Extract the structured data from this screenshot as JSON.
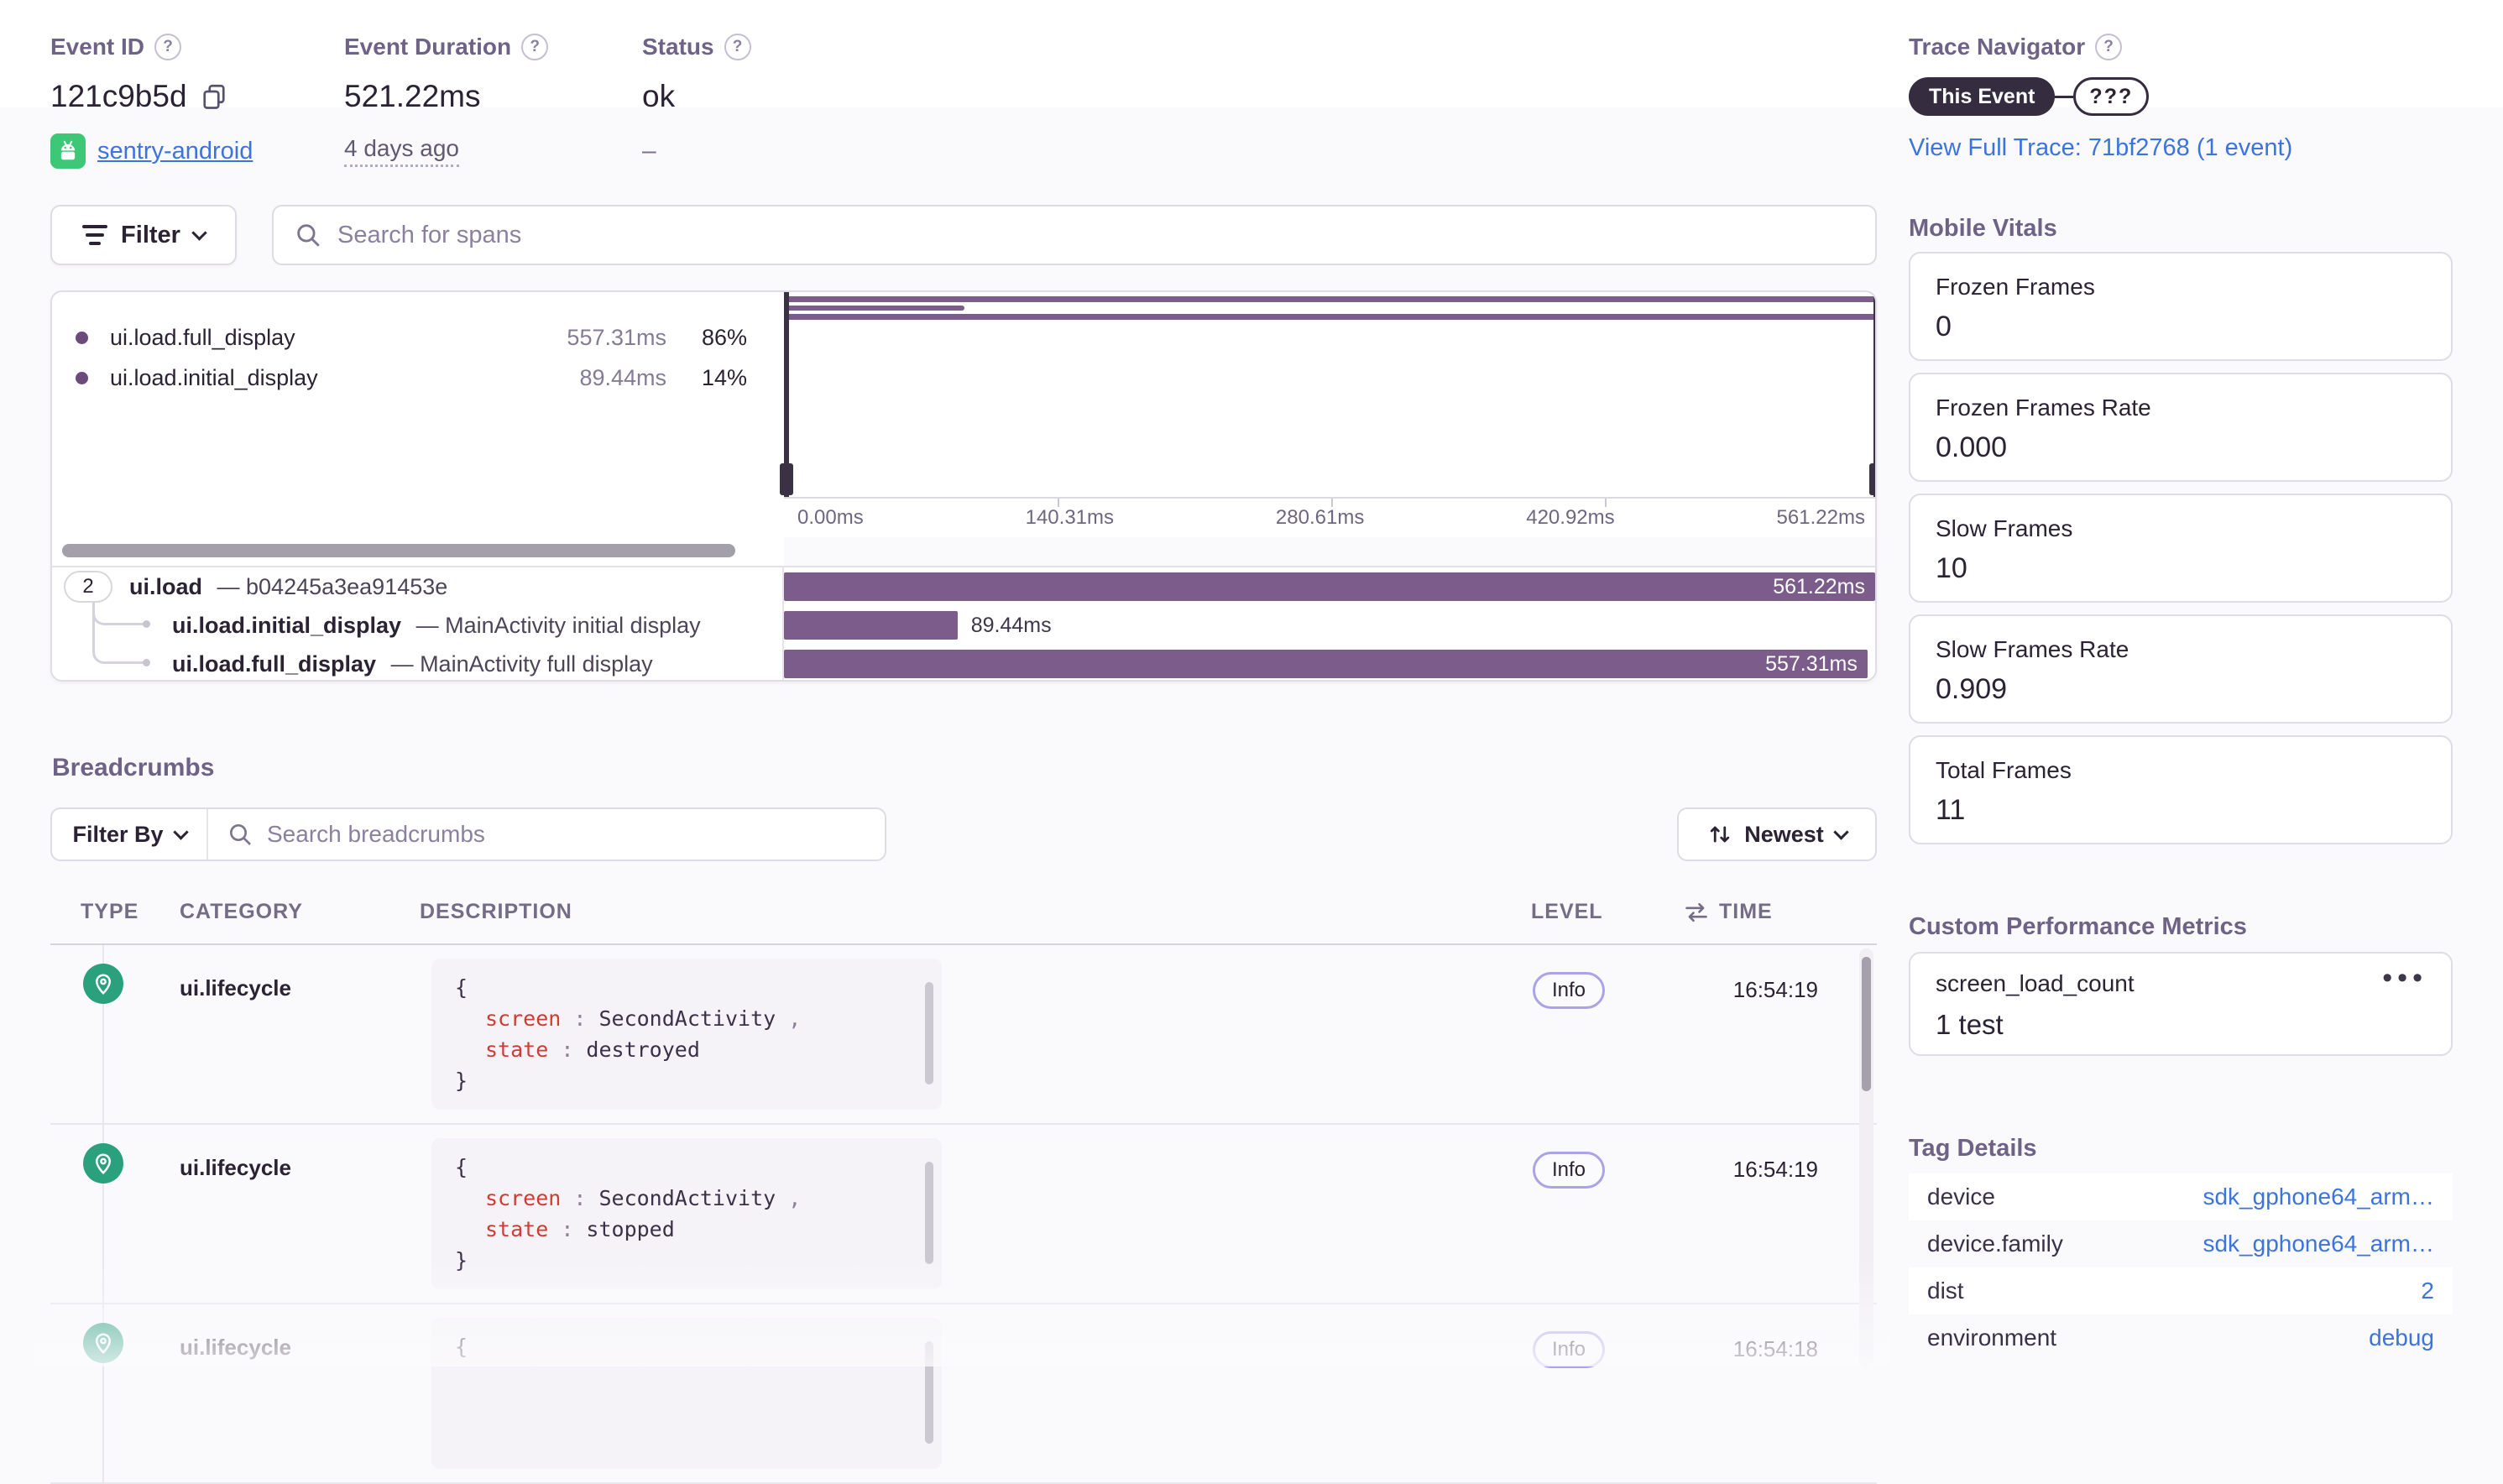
{
  "colors": {
    "accent_bar_purple": "#7B5C8A",
    "dark_pill_purple": "#352C3F",
    "link_blue": "#3C74DD",
    "section_label_gray": "#6F6287",
    "text_dark": "#2B2233",
    "breadcrumb_green": "#2AA07D",
    "android_green": "#3DC878",
    "code_key_red": "#D03B34",
    "info_badge_border": "#ABA2E8"
  },
  "icons": {
    "help": "?",
    "ellipsis": "•••"
  },
  "header": {
    "event_id": {
      "label": "Event ID",
      "value": "121c9b5d",
      "project": "sentry-android"
    },
    "event_duration": {
      "label": "Event Duration",
      "value": "521.22ms",
      "age": "4 days ago"
    },
    "status": {
      "label": "Status",
      "value": "ok",
      "sub": "–"
    }
  },
  "trace_navigator": {
    "label": "Trace Navigator",
    "this_event_pill": "This Event",
    "next_pill": "???",
    "link": "View Full Trace: 71bf2768 (1 event)"
  },
  "span_toolbar": {
    "filter_label": "Filter",
    "search_placeholder": "Search for spans"
  },
  "span_legend": {
    "rows": [
      {
        "name": "ui.load.full_display",
        "duration": "557.31ms",
        "pct": "86%"
      },
      {
        "name": "ui.load.initial_display",
        "duration": "89.44ms",
        "pct": "14%"
      }
    ]
  },
  "minimap": {
    "axis_labels": [
      "0.00ms",
      "140.31ms",
      "280.61ms",
      "420.92ms",
      "561.22ms"
    ],
    "bar1_style": "width:100%",
    "bar2_style": "width:16%",
    "bar3_style": "width:99.3%"
  },
  "span_tree": {
    "rows": [
      {
        "count": "2",
        "name": "ui.load",
        "suffix": "— b04245a3ea91453e",
        "duration": "561.22ms",
        "bar_style": "width:100%"
      },
      {
        "name": "ui.load.initial_display",
        "suffix": "— MainActivity initial display",
        "duration": "89.44ms",
        "bar_style": "width:15.9%"
      },
      {
        "name": "ui.load.full_display",
        "suffix": "— MainActivity full display",
        "duration": "557.31ms",
        "bar_style": "width:99.3%"
      }
    ]
  },
  "breadcrumbs": {
    "title": "Breadcrumbs",
    "filter_by_label": "Filter By",
    "search_placeholder": "Search breadcrumbs",
    "sort_label": "Newest",
    "columns": {
      "type": "TYPE",
      "category": "CATEGORY",
      "description": "DESCRIPTION",
      "level": "LEVEL",
      "time": "TIME"
    },
    "rows": [
      {
        "category": "ui.lifecycle",
        "level": "Info",
        "time": "16:54:19",
        "code": {
          "open": "{",
          "close": "}",
          "pairs": [
            {
              "key": "screen",
              "colon": ":",
              "value": "SecondActivity",
              "comma": ","
            },
            {
              "key": "state",
              "colon": ":",
              "value": "destroyed",
              "comma": ""
            }
          ]
        }
      },
      {
        "category": "ui.lifecycle",
        "level": "Info",
        "time": "16:54:19",
        "code": {
          "open": "{",
          "close": "}",
          "pairs": [
            {
              "key": "screen",
              "colon": ":",
              "value": "SecondActivity",
              "comma": ","
            },
            {
              "key": "state",
              "colon": ":",
              "value": "stopped",
              "comma": ""
            }
          ]
        }
      },
      {
        "category": "ui.lifecycle",
        "level": "Info",
        "time": "16:54:18",
        "code": {
          "open": "{"
        }
      }
    ]
  },
  "mobile_vitals": {
    "title": "Mobile Vitals",
    "cards": [
      {
        "label": "Frozen Frames",
        "value": "0"
      },
      {
        "label": "Frozen Frames Rate",
        "value": "0.000"
      },
      {
        "label": "Slow Frames",
        "value": "10"
      },
      {
        "label": "Slow Frames Rate",
        "value": "0.909"
      },
      {
        "label": "Total Frames",
        "value": "11"
      }
    ]
  },
  "custom_metrics": {
    "title": "Custom Performance Metrics",
    "card": {
      "name": "screen_load_count",
      "value": "1 test"
    }
  },
  "tag_details": {
    "title": "Tag Details",
    "rows": [
      {
        "key": "device",
        "value": "sdk_gphone64_arm…"
      },
      {
        "key": "device.family",
        "value": "sdk_gphone64_arm…"
      },
      {
        "key": "dist",
        "value": "2"
      },
      {
        "key": "environment",
        "value": "debug"
      }
    ]
  }
}
